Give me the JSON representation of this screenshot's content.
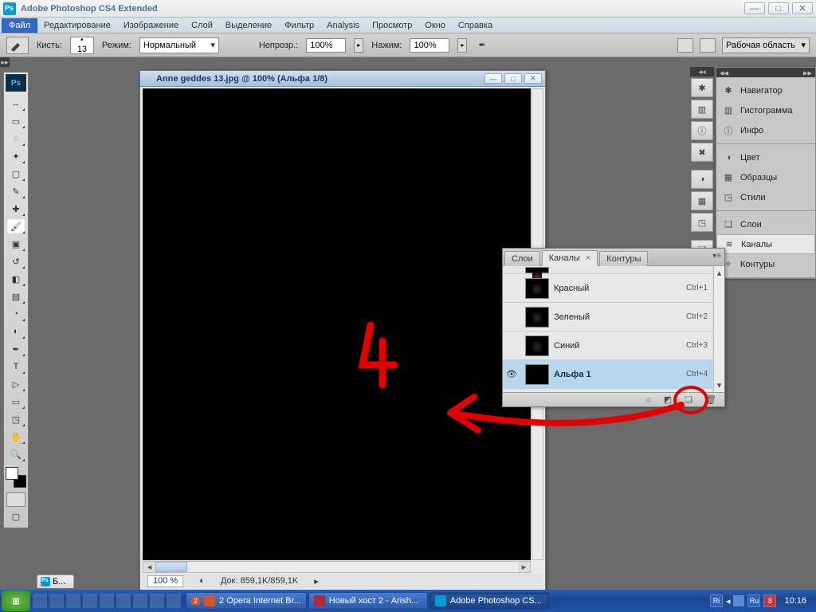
{
  "window": {
    "title": "Adobe Photoshop CS4 Extended"
  },
  "menu": {
    "items": [
      "Файл",
      "Редактирование",
      "Изображение",
      "Слой",
      "Выделение",
      "Фильтр",
      "Analysis",
      "Просмотр",
      "Окно",
      "Справка"
    ],
    "highlighted": 0
  },
  "options": {
    "brush_label": "Кисть:",
    "brush_size": "13",
    "mode_label": "Режим:",
    "mode_value": "Нормальный",
    "opacity_label": "Непрозр.:",
    "opacity_value": "100%",
    "flow_label": "Нажим:",
    "flow_value": "100%",
    "workspace_label": "Рабочая область",
    "arrow": "▸"
  },
  "document": {
    "title": "Anne geddes 13.jpg @ 100% (Альфа 1/8)",
    "zoom": "100 %",
    "docinfo": "Док: 859,1K/859,1K"
  },
  "doctab": {
    "label": "Б..."
  },
  "right_icons": [
    "compass-icon",
    "bars-icon",
    "info-icon",
    "palette-icon",
    "grid-icon",
    "text-icon",
    "layers-icon",
    "channels-icon",
    "paths-icon"
  ],
  "right_panels": {
    "group1": [
      {
        "icon": "✱",
        "label": "Навигатор"
      },
      {
        "icon": "▥",
        "label": "Гистограмма"
      },
      {
        "icon": "ⓘ",
        "label": "Инфо"
      }
    ],
    "group2": [
      {
        "icon": "◑",
        "label": "Цвет"
      },
      {
        "icon": "▦",
        "label": "Образцы"
      },
      {
        "icon": "◳",
        "label": "Стили"
      }
    ],
    "group3": [
      {
        "icon": "❏",
        "label": "Слои"
      },
      {
        "icon": "≋",
        "label": "Каналы"
      },
      {
        "icon": "✧",
        "label": "Контуры"
      }
    ],
    "active": "Каналы"
  },
  "channels_panel": {
    "tabs": [
      "Слои",
      "Каналы",
      "Контуры"
    ],
    "active_tab": 1,
    "rows": [
      {
        "name": "Красный",
        "shortcut": "Ctrl+1",
        "eye": false,
        "thumb": "dark"
      },
      {
        "name": "Зеленый",
        "shortcut": "Ctrl+2",
        "eye": false,
        "thumb": "dark"
      },
      {
        "name": "Синий",
        "shortcut": "Ctrl+3",
        "eye": false,
        "thumb": "dark"
      },
      {
        "name": "Альфа 1",
        "shortcut": "Ctrl+4",
        "eye": true,
        "thumb": "black",
        "selected": true
      }
    ],
    "footer_icons": [
      "○",
      "◩",
      "❏",
      "🗑"
    ]
  },
  "annotation": {
    "number": "4"
  },
  "taskbar": {
    "buttons": [
      {
        "icon": "#d0542d",
        "label": "2 Opera Internet Br...",
        "badge": "2"
      },
      {
        "icon": "#b3263c",
        "label": "Новый хост 2 - Arish..."
      },
      {
        "icon": "#0a99d2",
        "label": "Adobe Photoshop CS...",
        "active": true
      }
    ],
    "lang1": "Ri",
    "lang2": "Ru",
    "extra": "8",
    "clock": "10:16"
  }
}
